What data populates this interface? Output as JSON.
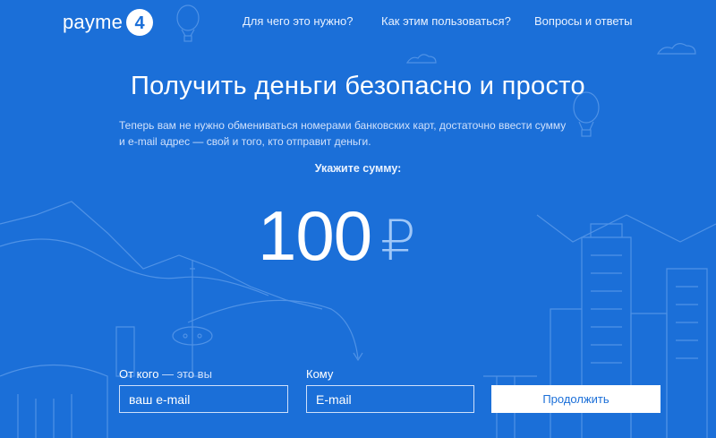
{
  "brand": {
    "name": "payme",
    "mark": "4"
  },
  "nav": [
    {
      "label": "Для чего это нужно?"
    },
    {
      "label": "Как этим пользоваться?"
    },
    {
      "label": "Вопросы и ответы"
    }
  ],
  "hero": {
    "title": "Получить деньги безопасно и просто",
    "description": "Теперь вам не нужно обмениваться номерами банковских карт, достаточно ввести сумму и e-mail адрес — свой и того, кто отправит деньги.",
    "amount_label": "Укажите сумму:",
    "amount_value": "100",
    "currency": "₽"
  },
  "form": {
    "from_label": "От кого",
    "from_hint": " — это вы",
    "from_placeholder": "ваш e-mail",
    "to_label": "Кому",
    "to_placeholder": "E-mail",
    "submit_label": "Продолжить"
  },
  "colors": {
    "background": "#1b6fd8",
    "line_art": "#5b9ae8",
    "currency": "#9fc7f8",
    "button_text": "#1b6fd8"
  }
}
